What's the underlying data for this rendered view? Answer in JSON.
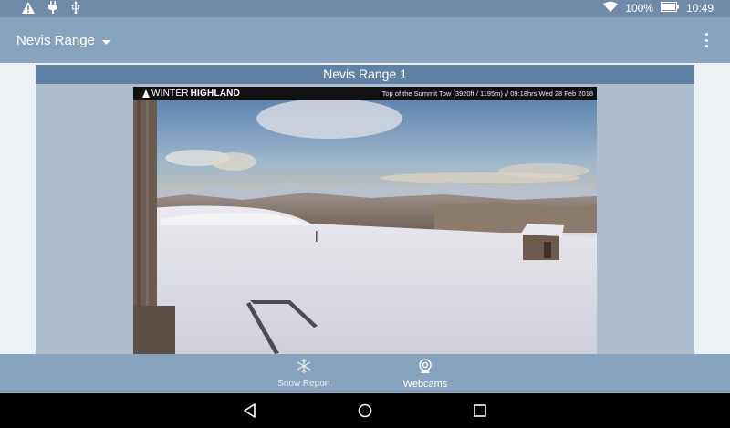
{
  "status": {
    "battery_percent": "100%",
    "time": "10:49"
  },
  "app_bar": {
    "title": "Nevis Range"
  },
  "card": {
    "title": "Nevis Range 1"
  },
  "webcam": {
    "brand_a": "WINTER",
    "brand_b": "HIGHLAND",
    "caption": "Top of the Summit Tow (3920ft / 1195m) // 09:18hrs Wed 28 Feb 2018"
  },
  "bottom_nav": [
    {
      "label": "Snow Report",
      "icon": "snowflake-icon",
      "active": false
    },
    {
      "label": "Webcams",
      "icon": "webcam-icon",
      "active": true
    }
  ],
  "colors": {
    "status_bar": "#6f8ba8",
    "app_bar": "#88a3bd",
    "card_header": "#5f82a4",
    "card_body": "#aebdcd"
  }
}
